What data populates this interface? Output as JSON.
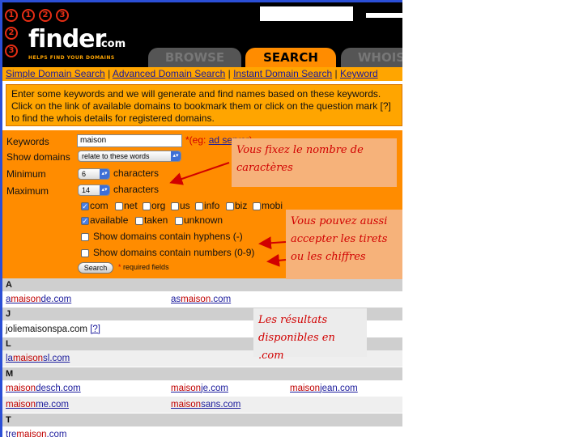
{
  "header": {
    "logo": {
      "digits": [
        "1",
        "2",
        "3"
      ],
      "finder": "finder",
      "com": ".com",
      "tagline": "HELPS FIND YOUR DOMAINS"
    },
    "tabs": [
      {
        "label": "BROWSE"
      },
      {
        "label": "SEARCH"
      },
      {
        "label": "WHOIS"
      }
    ]
  },
  "nav": {
    "links": [
      "Simple Domain Search",
      "Advanced Domain Search",
      "Instant Domain Search",
      "Keyword"
    ],
    "separator": "|"
  },
  "intro": "Enter some keywords and we will generate and find names based on these keywords. Click on the link of available domains to bookmark them or click on the question mark [?] to find the whois details for registered domains.",
  "form": {
    "keywords_label": "Keywords",
    "keywords_value": "maison",
    "eg_prefix": "*(eg: ",
    "eg_link": "ad server",
    "eg_suffix": ")",
    "show_domains_label": "Show domains",
    "show_domains_value": "relate to these words",
    "minimum_label": "Minimum",
    "minimum_value": "6",
    "maximum_label": "Maximum",
    "maximum_value": "14",
    "characters_label": "characters",
    "tlds": [
      {
        "label": "com",
        "checked": true
      },
      {
        "label": "net",
        "checked": false
      },
      {
        "label": "org",
        "checked": false
      },
      {
        "label": "us",
        "checked": false
      },
      {
        "label": "info",
        "checked": false
      },
      {
        "label": "biz",
        "checked": false
      },
      {
        "label": "mobi",
        "checked": false
      }
    ],
    "status": [
      {
        "label": "available",
        "checked": true
      },
      {
        "label": "taken",
        "checked": false
      },
      {
        "label": "unknown",
        "checked": false
      }
    ],
    "hyphens_label": "Show domains contain hyphens (-)",
    "numbers_label": "Show domains contain numbers (0-9)",
    "search_button": "Search",
    "required_star": "*",
    "required_note": "required fields"
  },
  "results": {
    "sections": [
      {
        "letter": "A",
        "rows": [
          [
            {
              "pre": "a",
              "mid": "maison",
              "post": "de.com"
            },
            {
              "pre": "as",
              "mid": "maison",
              "post": ".com"
            }
          ]
        ]
      },
      {
        "letter": "J",
        "rows": [
          [
            {
              "text": "joliemaisonspa.com",
              "whois": "[?]"
            }
          ]
        ]
      },
      {
        "letter": "L",
        "rows": [
          [
            {
              "pre": "la",
              "mid": "maison",
              "post": "sl.com"
            }
          ]
        ]
      },
      {
        "letter": "M",
        "rows": [
          [
            {
              "pre": "",
              "mid": "maison",
              "post": "desch.com"
            },
            {
              "pre": "",
              "mid": "maison",
              "post": "je.com"
            },
            {
              "pre": "",
              "mid": "maison",
              "post": "jean.com"
            }
          ],
          [
            {
              "pre": "",
              "mid": "maison",
              "post": "me.com"
            },
            {
              "pre": "",
              "mid": "maison",
              "post": "sans.com"
            }
          ]
        ]
      },
      {
        "letter": "T",
        "rows": [
          [
            {
              "pre": "tre",
              "mid": "maison",
              "post": ".com"
            }
          ]
        ]
      }
    ]
  },
  "annotations": {
    "note1": "Vous fixez le nombre de caractères",
    "note2": "Vous pouvez aussi accepter les tirets ou les chiffres",
    "note3": "Les résultats disponibles en .com"
  },
  "colors": {
    "accent": "#ff8c00",
    "link": "#1a1a9c",
    "keyword_highlight": "#c00000",
    "annotation": "#d10000"
  }
}
